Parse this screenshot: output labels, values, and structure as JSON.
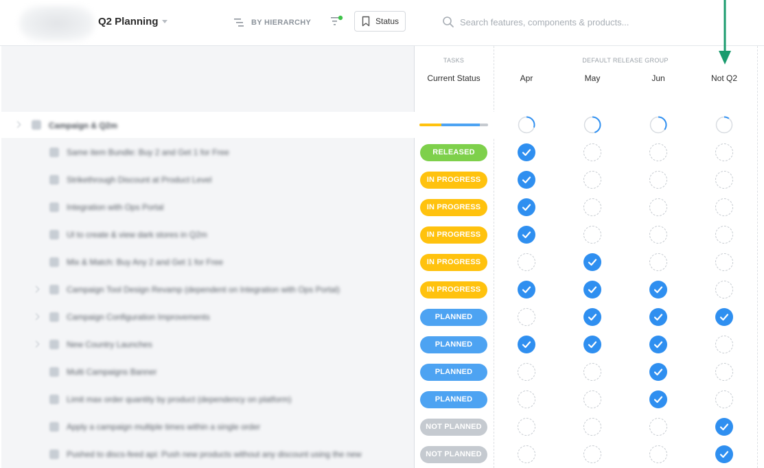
{
  "header": {
    "title": "Q2 Planning",
    "view_label": "BY HIERARCHY",
    "status_button": "Status",
    "search_placeholder": "Search features, components & products..."
  },
  "columns": {
    "tasks_group": "TASKS",
    "release_group": "DEFAULT RELEASE GROUP",
    "status_col": "Current Status",
    "months": [
      "Apr",
      "May",
      "Jun",
      "Not Q2"
    ]
  },
  "colors": {
    "released": "#7ed04b",
    "in_progress": "#ffc20e",
    "planned": "#4da3f2",
    "not_planned": "#c5cad0",
    "check": "#2f8ff0",
    "arrow": "#1a9b6e"
  },
  "campaign": {
    "label": "Campaign & Q2m",
    "progress": [
      {
        "color": "#ffc20e",
        "fraction": 0.32
      },
      {
        "color": "#4da3f2",
        "fraction": 0.56
      },
      {
        "color": "#c5cad0",
        "fraction": 0.12
      }
    ],
    "month_progress": [
      0.3,
      0.45,
      0.35,
      0.1
    ]
  },
  "rows": [
    {
      "label": "Same item Bundle: Buy 2 and Get 1 for Free",
      "status": "RELEASED",
      "kind": "released",
      "months": [
        true,
        false,
        false,
        false
      ],
      "expandable": false
    },
    {
      "label": "Strikethrough Discount at Product Level",
      "status": "IN PROGRESS",
      "kind": "in_progress",
      "months": [
        true,
        false,
        false,
        false
      ],
      "expandable": false
    },
    {
      "label": "Integration with Ops Portal",
      "status": "IN PROGRESS",
      "kind": "in_progress",
      "months": [
        true,
        false,
        false,
        false
      ],
      "expandable": false
    },
    {
      "label": "Ul to create & view dark stores in Q2m",
      "status": "IN PROGRESS",
      "kind": "in_progress",
      "months": [
        true,
        false,
        false,
        false
      ],
      "expandable": false
    },
    {
      "label": "Mix & Match: Buy Any 2 and Get 1 for Free",
      "status": "IN PROGRESS",
      "kind": "in_progress",
      "months": [
        false,
        true,
        false,
        false
      ],
      "expandable": false
    },
    {
      "label": "Campaign Tool Design Revamp (dependent on Integration with Ops Portal)",
      "status": "IN PROGRESS",
      "kind": "in_progress",
      "months": [
        true,
        true,
        true,
        false
      ],
      "expandable": true
    },
    {
      "label": "Campaign Configuration Improvements",
      "status": "PLANNED",
      "kind": "planned",
      "months": [
        false,
        true,
        true,
        true
      ],
      "expandable": true
    },
    {
      "label": "New Country Launches",
      "status": "PLANNED",
      "kind": "planned",
      "months": [
        true,
        true,
        true,
        false
      ],
      "expandable": true
    },
    {
      "label": "Multi Campaigns Banner",
      "status": "PLANNED",
      "kind": "planned",
      "months": [
        false,
        false,
        true,
        false
      ],
      "expandable": false
    },
    {
      "label": "Limit max order quantity by product (dependency on platform)",
      "status": "PLANNED",
      "kind": "planned",
      "months": [
        false,
        false,
        true,
        false
      ],
      "expandable": false
    },
    {
      "label": "Apply a campaign multiple times within a single order",
      "status": "NOT PLANNED",
      "kind": "not_planned",
      "months": [
        false,
        false,
        false,
        true
      ],
      "expandable": false
    },
    {
      "label": "Pushed to discs-feed api: Push new products without any discount using the new",
      "status": "NOT PLANNED",
      "kind": "not_planned",
      "months": [
        false,
        false,
        false,
        true
      ],
      "expandable": false
    }
  ]
}
